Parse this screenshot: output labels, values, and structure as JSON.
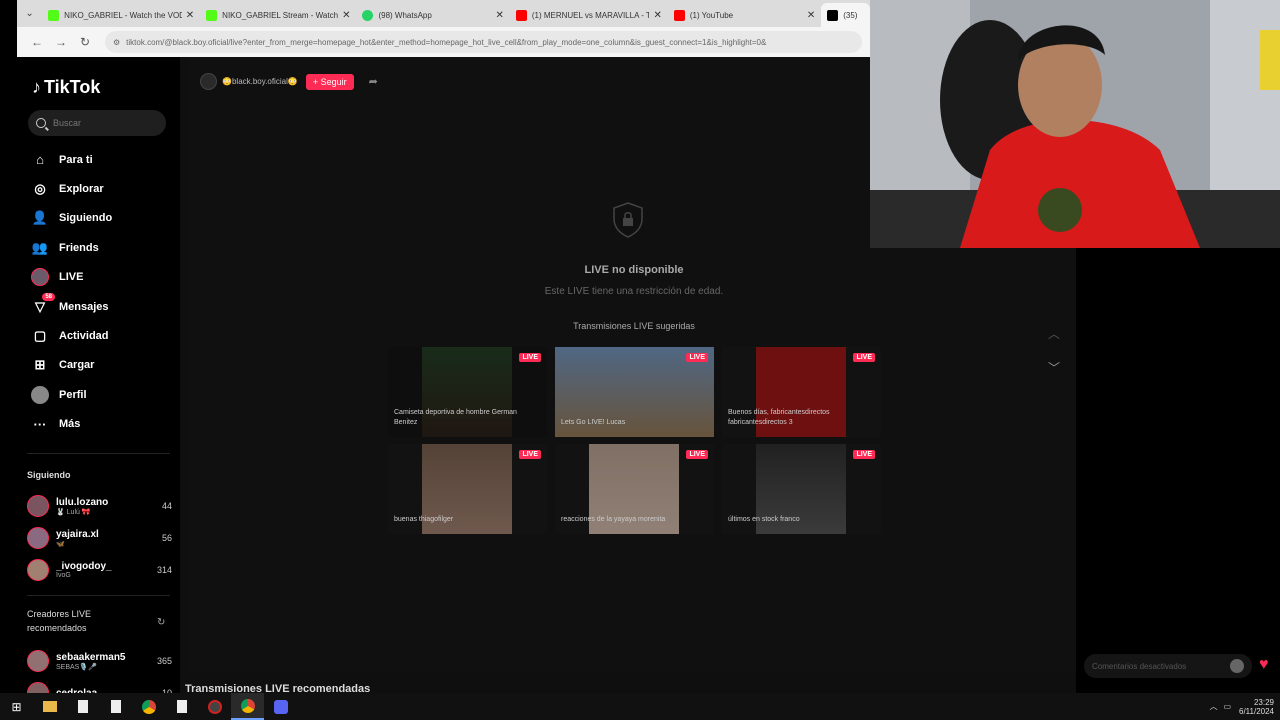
{
  "browser": {
    "tabs": [
      {
        "label": "NIKO_GABRIEL - Watch the VOD",
        "color": "#53fc18",
        "active": false
      },
      {
        "label": "NIKO_GABRIEL Stream - Watch",
        "color": "#53fc18",
        "active": false
      },
      {
        "label": "(98) WhatsApp",
        "color": "#25d366",
        "active": false
      },
      {
        "label": "(1) MERNUEL vs MARAVILLA - T",
        "color": "#ff0000",
        "active": false
      },
      {
        "label": "(1) YouTube",
        "color": "#ff0000",
        "active": false
      },
      {
        "label": "(35)",
        "color": "#000000",
        "active": true
      }
    ],
    "url": "tiktok.com/@black.boy.oficial/live?enter_from_merge=homepage_hot&enter_method=homepage_hot_live_cell&from_play_mode=one_column&is_guest_connect=1&is_highlight=0&"
  },
  "sidebar": {
    "logo": "TikTok",
    "search_placeholder": "Buscar",
    "nav": [
      {
        "label": "Para ti",
        "icon": "home-icon"
      },
      {
        "label": "Explorar",
        "icon": "compass-icon"
      },
      {
        "label": "Siguiendo",
        "icon": "following-icon"
      },
      {
        "label": "Friends",
        "icon": "friends-icon"
      },
      {
        "label": "LIVE",
        "icon": "live-avatar-icon"
      },
      {
        "label": "Mensajes",
        "icon": "messages-icon",
        "badge": "58"
      },
      {
        "label": "Actividad",
        "icon": "activity-icon"
      },
      {
        "label": "Cargar",
        "icon": "upload-icon"
      },
      {
        "label": "Perfil",
        "icon": "profile-avatar-icon"
      },
      {
        "label": "Más",
        "icon": "more-icon"
      }
    ],
    "following_title": "Siguiendo",
    "following": [
      {
        "name": "lulu.lozano",
        "sub": "🐰 Lulú 🎀",
        "count": "44"
      },
      {
        "name": "yajaira.xl",
        "sub": "🦋",
        "count": "56"
      },
      {
        "name": "_ivogodoy_",
        "sub": "IvoG",
        "count": "314"
      }
    ],
    "reco_title": "Creadores LIVE recomendados",
    "reco": [
      {
        "name": "sebaakerman5",
        "sub": "SEBAS🎙️🎤",
        "count": "365"
      },
      {
        "name": "cedrolaa",
        "sub": "",
        "count": "10"
      }
    ]
  },
  "main": {
    "profile_name": "😳black.boy.oficial😳",
    "follow_label": "+ Seguir",
    "unavailable_title": "LIVE no disponible",
    "unavailable_sub": "Este LIVE tiene una restricción de edad.",
    "suggested_title": "Transmisiones LIVE sugeridas",
    "live_badge": "LIVE",
    "cards": [
      {
        "title": "Camiseta deportiva de hombre German Benitez",
        "thumb": "#3a4a3a"
      },
      {
        "title": "Lets Go LIVE! Lucas",
        "thumb": "#5a7a9a"
      },
      {
        "title": "Buenos días, fabricantesdirectos fabricantesdirectos 3",
        "thumb": "#a01818"
      },
      {
        "title": "buenas thiagofilger",
        "thumb": "#8a6a50"
      },
      {
        "title": "reacciones de la yayaya morenita",
        "thumb": "#c0a898"
      },
      {
        "title": "últimos en stock franco",
        "thumb": "#555555"
      }
    ],
    "bottom_heading": "Transmisiones LIVE recomendadas"
  },
  "chat": {
    "placeholder": "Comentarios desactivados"
  },
  "taskbar": {
    "time": "23:29",
    "date": "6/11/2024"
  }
}
